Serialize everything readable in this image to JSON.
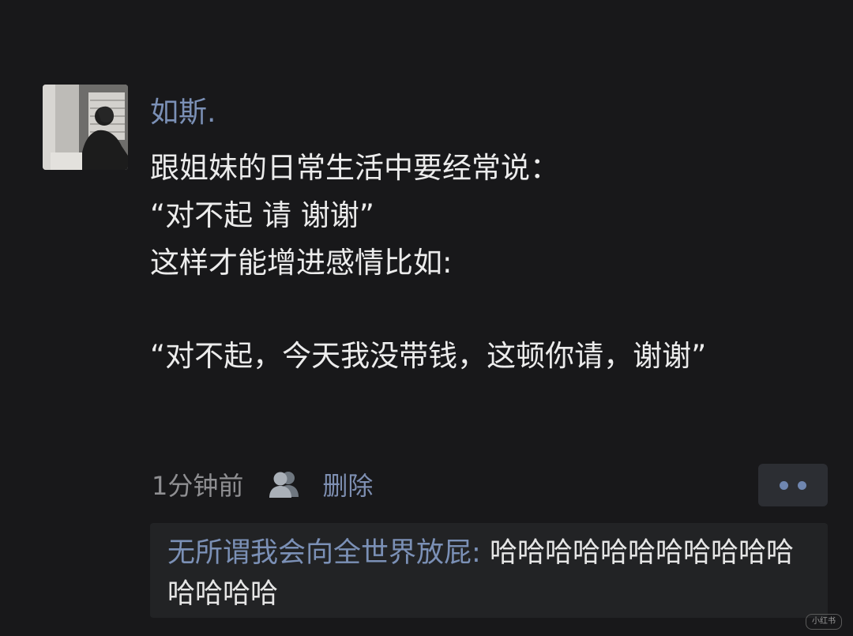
{
  "post": {
    "author": "如斯.",
    "content_lines": [
      "跟姐妹的日常生活中要经常说：",
      "“对不起 请 谢谢”",
      "这样才能增进感情比如:",
      "",
      "“对不起，今天我没带钱，这顿你请，谢谢”"
    ],
    "time": "1分钟前",
    "visibility_icon": "people-icon",
    "delete_label": "删除",
    "more_icon": "more-dots-icon"
  },
  "comments": [
    {
      "commenter": "无所谓我会向全世界放屁",
      "separator": ": ",
      "text": "哈哈哈哈哈哈哈哈哈哈哈哈哈哈哈"
    }
  ],
  "watermark": "小红书",
  "colors": {
    "background": "#18181a",
    "name_link": "#7b90b6",
    "comment_area": "#222325"
  }
}
